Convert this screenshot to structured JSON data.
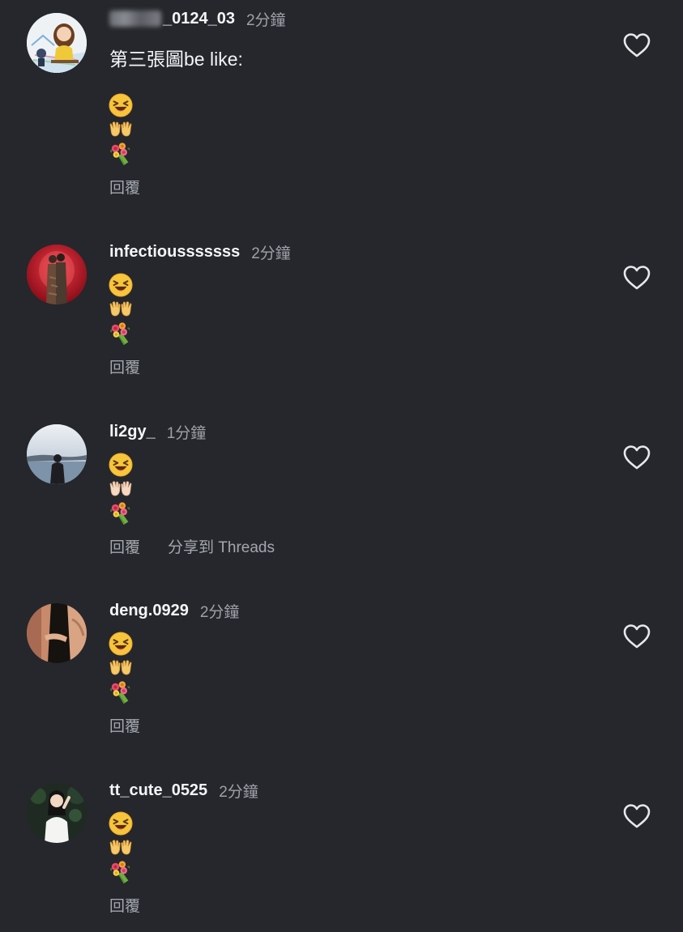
{
  "comments": [
    {
      "username": "_0124_03",
      "time": "2分鐘",
      "text": "第三張圖be like:",
      "reply_label": "回覆",
      "avatar_icon": "illustrated-girl-avatar"
    },
    {
      "username": "infectiousssssss",
      "time": "2分鐘",
      "reply_label": "回覆",
      "avatar_icon": "red-stage-photo-avatar"
    },
    {
      "username": "li2gy_",
      "time": "1分鐘",
      "reply_label": "回覆",
      "share_label": "分享到 Threads",
      "avatar_icon": "lake-silhouette-avatar"
    },
    {
      "username": "deng.0929",
      "time": "2分鐘",
      "reply_label": "回覆",
      "avatar_icon": "couple-photo-avatar"
    },
    {
      "username": "tt_cute_0525",
      "time": "2分鐘",
      "reply_label": "回覆",
      "avatar_icon": "portrait-photo-avatar"
    }
  ],
  "emojis": [
    "laughing-face-icon",
    "raised-hands-icon",
    "bouquet-icon"
  ],
  "colors": {
    "background": "#25272c",
    "username": "#f4f5f7",
    "secondary_text": "#9ea1a8",
    "heart_outline": "#e7e8ea"
  }
}
